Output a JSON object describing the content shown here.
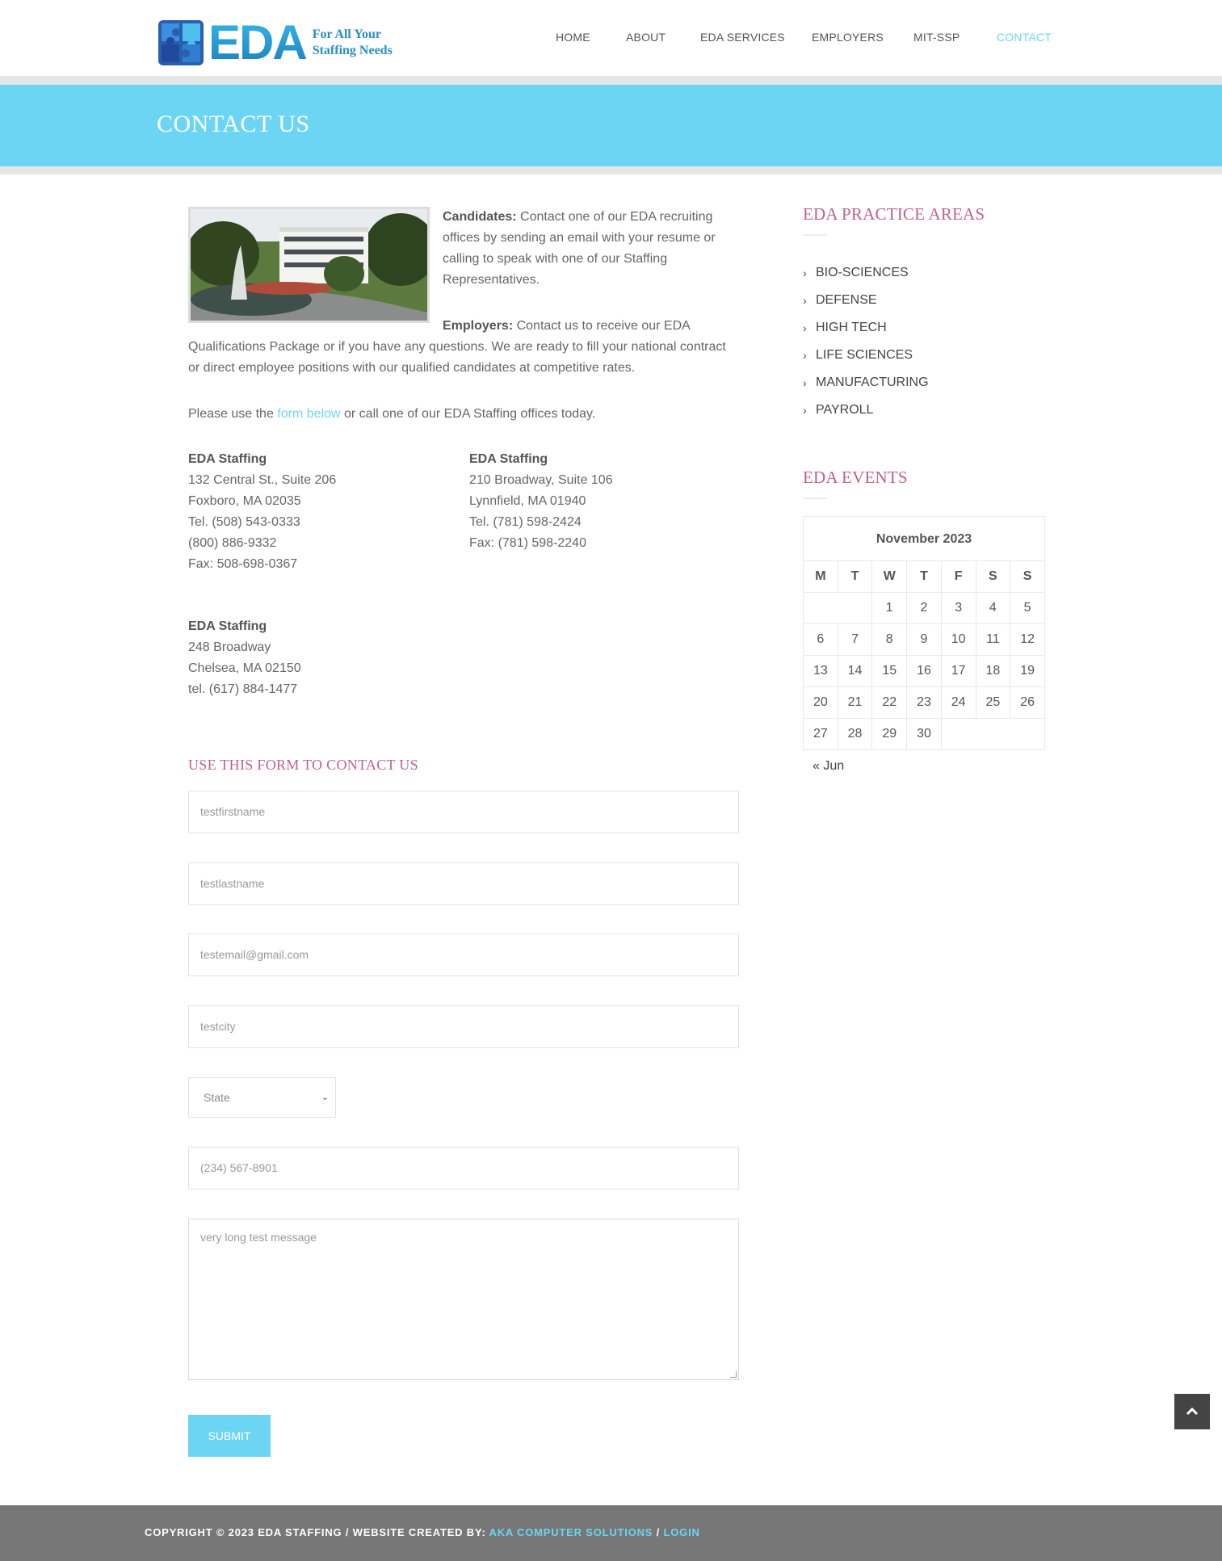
{
  "logo": {
    "text": "EDA",
    "tagline_line1": "For All Your",
    "tagline_line2": "Staffing Needs"
  },
  "nav": {
    "items": [
      {
        "label": "HOME"
      },
      {
        "label": "ABOUT"
      },
      {
        "label": "EDA SERVICES"
      },
      {
        "label": "EMPLOYERS"
      },
      {
        "label": "MIT-SSP"
      },
      {
        "label": "CONTACT",
        "active": true
      }
    ]
  },
  "banner": {
    "title": "CONTACT US"
  },
  "intro": {
    "candidates_label": "Candidates:",
    "candidates_text": " Contact one of our EDA recruiting offices by sending an email with your resume or calling to speak with one of our Staffing Representatives.",
    "employers_label": "Employers:",
    "employers_text": " Contact us to receive our EDA Qualifications Package or if you have any questions. We are ready to fill your national contract or direct employee positions with our qualified candidates at competitive rates.",
    "please_prefix": "Please use the ",
    "form_link": "form below",
    "please_suffix": " or call one of our EDA Staffing offices today."
  },
  "offices": [
    {
      "name": "EDA Staffing",
      "lines": [
        "132 Central St., Suite 206",
        "Foxboro, MA 02035",
        "Tel. (508) 543-0333",
        "(800) 886-9332",
        "Fax: 508-698-0367"
      ]
    },
    {
      "name": "EDA Staffing",
      "lines": [
        "210 Broadway, Suite 106",
        "Lynnfield, MA 01940",
        "Tel. (781) 598-2424",
        "Fax: (781) 598-2240"
      ]
    },
    {
      "name": "EDA Staffing",
      "lines": [
        "248 Broadway",
        "Chelsea, MA 02150",
        "tel. (617) 884-1477"
      ]
    }
  ],
  "form": {
    "title": "USE THIS FORM TO CONTACT US",
    "first_name": "testfirstname",
    "last_name": "testlastname",
    "email": "testemail@gmail.com",
    "city": "testcity",
    "state": "State",
    "phone": "(234) 567-8901",
    "message": "very long test message",
    "submit": "SUBMIT"
  },
  "sidebar": {
    "areas_title": "EDA PRACTICE AREAS",
    "areas": [
      "BIO-SCIENCES",
      "DEFENSE",
      "HIGH TECH",
      "LIFE SCIENCES",
      "MANUFACTURING",
      "PAYROLL"
    ],
    "events_title": "EDA EVENTS",
    "calendar": {
      "caption": "November 2023",
      "days": [
        "M",
        "T",
        "W",
        "T",
        "F",
        "S",
        "S"
      ],
      "weeks": [
        [
          "",
          "",
          "1",
          "2",
          "3",
          "4",
          "5"
        ],
        [
          "6",
          "7",
          "8",
          "9",
          "10",
          "11",
          "12"
        ],
        [
          "13",
          "14",
          "15",
          "16",
          "17",
          "18",
          "19"
        ],
        [
          "20",
          "21",
          "22",
          "23",
          "24",
          "25",
          "26"
        ],
        [
          "27",
          "28",
          "29",
          "30",
          "",
          "",
          ""
        ]
      ],
      "prev": "« Jun"
    }
  },
  "footer": {
    "text": "COPYRIGHT © 2023 EDA STAFFING / WEBSITE CREATED BY: ",
    "author": "AKA COMPUTER SOLUTIONS",
    "sep": " / ",
    "login": "LOGIN"
  },
  "colors": {
    "accent": "#6dd5f4",
    "heading": "#c0618f",
    "footer": "#777777"
  }
}
